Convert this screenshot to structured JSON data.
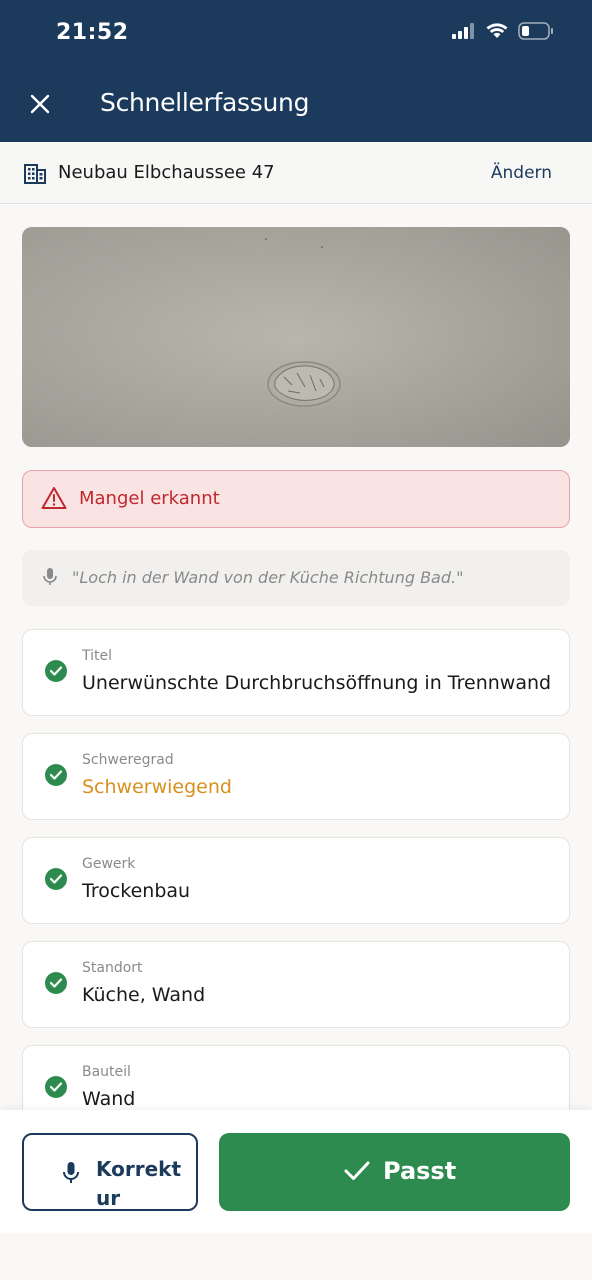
{
  "status_bar": {
    "time": "21:52"
  },
  "header": {
    "title": "Schnellerfassung",
    "close_icon": "close-icon"
  },
  "project": {
    "name": "Neubau Elbchaussee 47",
    "change_label": "Ändern",
    "icon": "building-icon"
  },
  "alert": {
    "text": "Mangel erkannt",
    "icon": "warning-triangle-icon"
  },
  "transcript": {
    "text": "\"Loch in der Wand von der Küche Richtung Bad.\"",
    "icon": "microphone-icon"
  },
  "fields": [
    {
      "label": "Titel",
      "value": "Unerwünschte Durchbruchsöffnung in Trennwand"
    },
    {
      "label": "Schweregrad",
      "value": "Schwerwiegend"
    },
    {
      "label": "Gewerk",
      "value": "Trockenbau"
    },
    {
      "label": "Standort",
      "value": "Küche, Wand"
    },
    {
      "label": "Bauteil",
      "value": "Wand"
    }
  ],
  "actions": {
    "correct_label": "Korrekt",
    "correct_label_cut": "ur",
    "ok_label": "Passt"
  },
  "colors": {
    "header": "#1b3a5c",
    "success": "#2e8b4f",
    "danger": "#c0282f",
    "warning": "#d8901d"
  }
}
